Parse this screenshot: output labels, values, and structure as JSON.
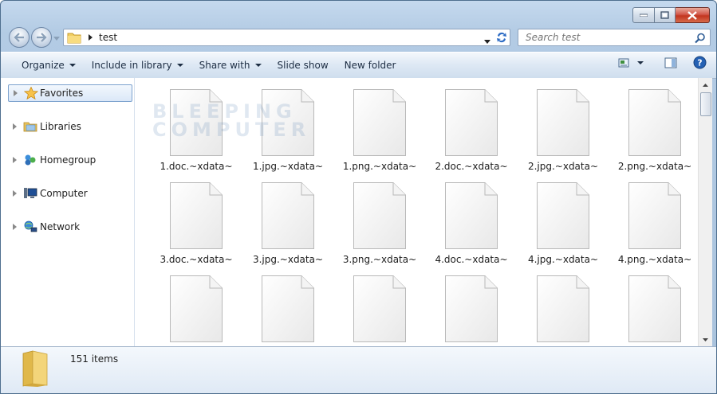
{
  "window": {
    "title": ""
  },
  "address": {
    "path_segment": "test"
  },
  "search": {
    "placeholder": "Search test"
  },
  "toolbar": {
    "organize": "Organize",
    "include_in_library": "Include in library",
    "share_with": "Share with",
    "slide_show": "Slide show",
    "new_folder": "New folder"
  },
  "nav": {
    "items": [
      {
        "label": "Favorites",
        "icon": "star-icon"
      },
      {
        "label": "Libraries",
        "icon": "libraries-icon"
      },
      {
        "label": "Homegroup",
        "icon": "homegroup-icon"
      },
      {
        "label": "Computer",
        "icon": "computer-icon"
      },
      {
        "label": "Network",
        "icon": "network-icon"
      }
    ]
  },
  "files": [
    {
      "name": "1.doc.~xdata~"
    },
    {
      "name": "1.jpg.~xdata~"
    },
    {
      "name": "1.png.~xdata~"
    },
    {
      "name": "2.doc.~xdata~"
    },
    {
      "name": "2.jpg.~xdata~"
    },
    {
      "name": "2.png.~xdata~"
    },
    {
      "name": "3.doc.~xdata~"
    },
    {
      "name": "3.jpg.~xdata~"
    },
    {
      "name": "3.png.~xdata~"
    },
    {
      "name": "4.doc.~xdata~"
    },
    {
      "name": "4.jpg.~xdata~"
    },
    {
      "name": "4.png.~xdata~"
    },
    {
      "name": ""
    },
    {
      "name": ""
    },
    {
      "name": ""
    },
    {
      "name": ""
    },
    {
      "name": ""
    },
    {
      "name": ""
    }
  ],
  "watermark": {
    "line1": "BLEEPING",
    "line2": "COMPUTER"
  },
  "details": {
    "item_count": "151 items"
  },
  "colors": {
    "accent": "#3a6ea5",
    "chrome": "#c5d9ee",
    "selection": "#dbe8f8"
  }
}
